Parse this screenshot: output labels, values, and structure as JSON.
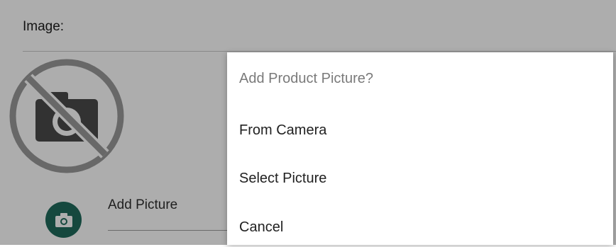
{
  "form": {
    "image_label": "Image:",
    "add_picture_label": "Add Picture",
    "placeholder_icon": "no-photo-icon",
    "fab_icon": "camera-icon",
    "accent_color": "#1f6b5c"
  },
  "dialog": {
    "title": "Add Product Picture?",
    "options": [
      {
        "label": "From Camera"
      },
      {
        "label": "Select Picture"
      },
      {
        "label": "Cancel"
      }
    ]
  }
}
